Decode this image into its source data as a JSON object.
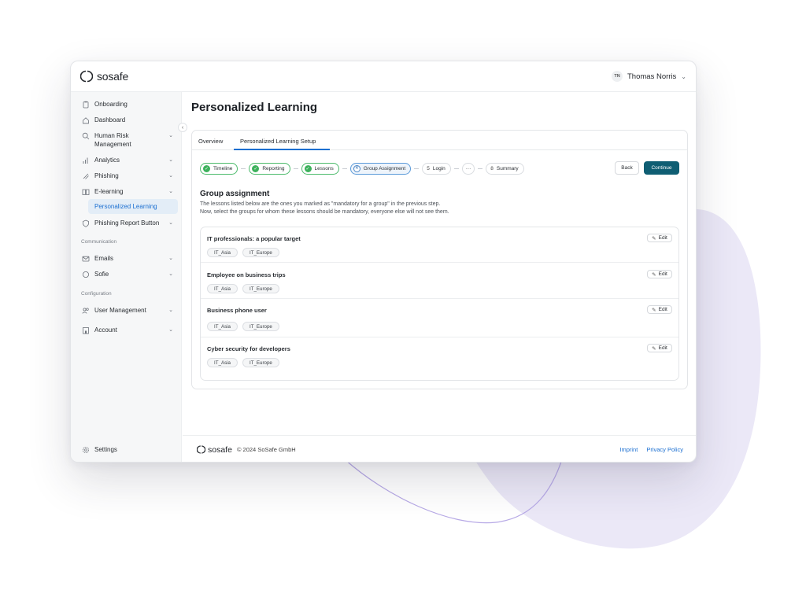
{
  "header": {
    "logo_text": "sosafe",
    "user_initials": "TN",
    "user_name": "Thomas Norris"
  },
  "sidebar": {
    "items": [
      {
        "label": "Onboarding",
        "icon": "clipboard-icon"
      },
      {
        "label": "Dashboard",
        "icon": "home-icon"
      },
      {
        "label": "Human Risk Management",
        "icon": "search-icon"
      },
      {
        "label": "Analytics",
        "icon": "bar-chart-icon"
      },
      {
        "label": "Phishing",
        "icon": "hook-icon"
      },
      {
        "label": "E-learning",
        "icon": "book-icon"
      },
      {
        "label": "Personalized Learning",
        "active": true
      },
      {
        "label": "Phishing Report Button",
        "icon": "shield-icon"
      }
    ],
    "section_communication": "Communication",
    "communication_items": [
      {
        "label": "Emails",
        "icon": "mail-icon"
      },
      {
        "label": "Sofie",
        "icon": "chat-icon"
      }
    ],
    "section_configuration": "Configuration",
    "configuration_items": [
      {
        "label": "User Management",
        "icon": "users-icon"
      },
      {
        "label": "Account",
        "icon": "building-icon"
      }
    ],
    "settings_label": "Settings"
  },
  "main": {
    "page_title": "Personalized Learning",
    "tabs": [
      {
        "label": "Overview"
      },
      {
        "label": "Personalized Learning Setup",
        "active": true
      }
    ],
    "steps": [
      {
        "label": "Timeline",
        "status": "done"
      },
      {
        "label": "Reporting",
        "status": "done"
      },
      {
        "label": "Lessons",
        "status": "done"
      },
      {
        "label": "Group Assignment",
        "number": "4",
        "status": "current"
      },
      {
        "label": "Login",
        "number": "5",
        "status": "todo"
      },
      {
        "label": "···",
        "status": "more"
      },
      {
        "label": "Summary",
        "number": "8",
        "status": "todo"
      }
    ],
    "back_label": "Back",
    "continue_label": "Continue",
    "section_title": "Group assignment",
    "description_line1": "The lessons listed below are the ones you marked as \"mandatory for a group\" in the previous step.",
    "description_line2": "Now, select the groups for whom these lessons should be mandatory, everyone else will not see them.",
    "edit_label": "Edit",
    "lessons": [
      {
        "title": "IT professionals: a popular target",
        "tags": [
          "IT_Asia",
          "IT_Europe"
        ]
      },
      {
        "title": "Employee on business trips",
        "tags": [
          "IT_Asia",
          "IT_Europe"
        ]
      },
      {
        "title": "Business phone user",
        "tags": [
          "IT_Asia",
          "IT_Europe"
        ]
      },
      {
        "title": "Cyber security for developers",
        "tags": [
          "IT_Asia",
          "IT_Europe"
        ]
      }
    ]
  },
  "footer": {
    "logo_text": "sosafe",
    "copyright": "© 2024 SoSafe GmbH",
    "imprint": "Imprint",
    "privacy": "Privacy Policy"
  },
  "colors": {
    "accent_blue": "#1b6fd1",
    "primary_button": "#0f5e73",
    "step_done_green": "#3db15c",
    "background_blob": "#e9e6f6"
  }
}
